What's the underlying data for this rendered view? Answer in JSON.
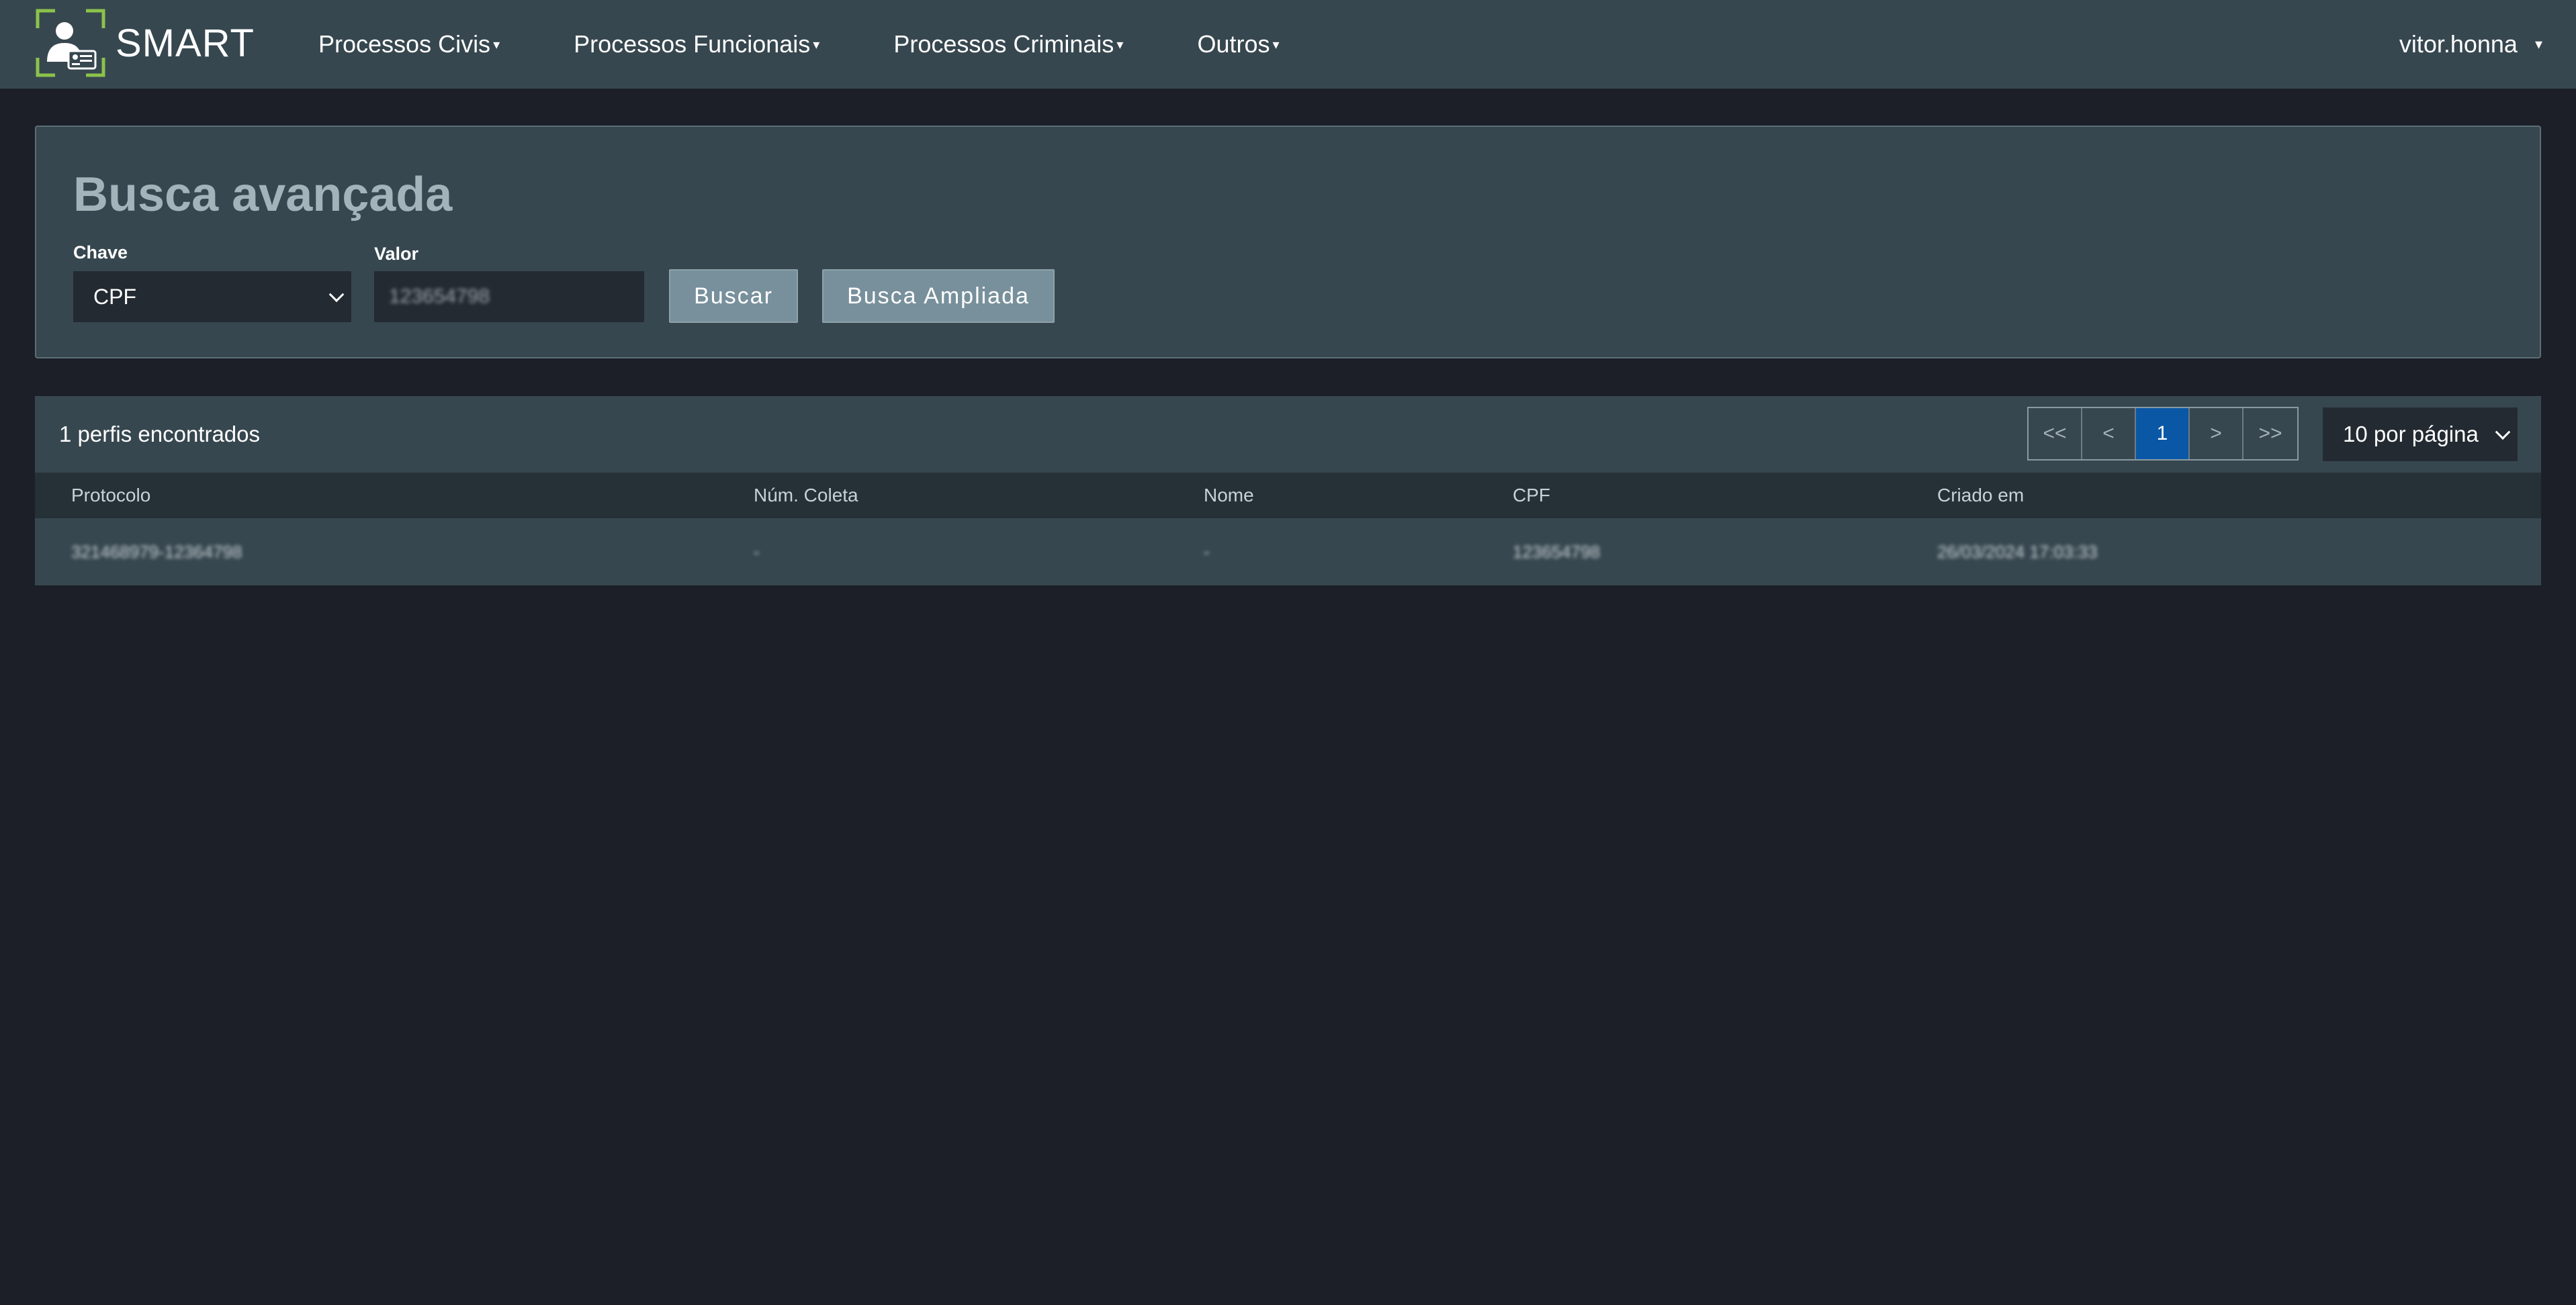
{
  "app": {
    "logo_text": "SMART",
    "colors": {
      "navbar": "#37474f",
      "background": "#1c1f28",
      "accent": "#0a57a5",
      "logo_green": "#8bc34a"
    }
  },
  "nav": {
    "items": [
      {
        "label": "Processos Civis"
      },
      {
        "label": "Processos Funcionais"
      },
      {
        "label": "Processos Criminais"
      },
      {
        "label": "Outros"
      }
    ],
    "caret": "▾",
    "user": "vitor.honna"
  },
  "search": {
    "title": "Busca avançada",
    "key_label": "Chave",
    "key_value": "CPF",
    "value_label": "Valor",
    "value_value": "123654798",
    "search_button": "Buscar",
    "extended_button": "Busca Ampliada"
  },
  "results": {
    "count_text": "1 perfis encontrados",
    "pager": {
      "first": "<<",
      "prev": "<",
      "page": "1",
      "next": ">",
      ">>": ">>",
      "last": ">>"
    },
    "per_page": "10 por página",
    "columns": [
      "Protocolo",
      "Núm. Coleta",
      "Nome",
      "CPF",
      "Criado em"
    ],
    "rows": [
      [
        "321468979-12364798",
        "-",
        "-",
        "123654798",
        "26/03/2024 17:03:33"
      ]
    ]
  }
}
